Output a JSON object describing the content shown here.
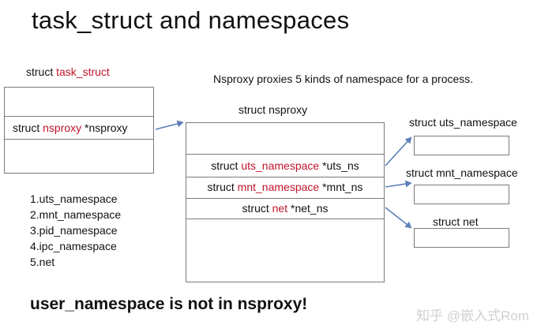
{
  "title": "task_struct and namespaces",
  "task_struct": {
    "header_plain": "struct ",
    "header_red": "task_struct",
    "row_plain1": "struct ",
    "row_red": "nsproxy",
    "row_plain2": " *nsproxy"
  },
  "note": "Nsproxy proxies 5 kinds of namespace for a process.",
  "nsproxy": {
    "header": "struct nsproxy",
    "rows": [
      {
        "plain1": "struct ",
        "red": "uts_namespace",
        "plain2": " *uts_ns"
      },
      {
        "plain1": "struct ",
        "red": "mnt_namespace",
        "plain2": " *mnt_ns"
      },
      {
        "plain1": "struct ",
        "red": "net",
        "plain2": " *net_ns"
      }
    ]
  },
  "targets": [
    {
      "label": "struct uts_namespace"
    },
    {
      "label": "struct mnt_namespace"
    },
    {
      "label": "struct net"
    }
  ],
  "list": [
    "1.uts_namespace",
    "2.mnt_namespace",
    "3.pid_namespace",
    "4.ipc_namespace",
    "5.net"
  ],
  "bottom_note": "user_namespace is not in nsproxy!",
  "watermark": "知乎 @嵌入式Rom",
  "colors": {
    "red": "#c0152a",
    "arrow": "#5d7fb8",
    "border": "#7a7a7a"
  }
}
